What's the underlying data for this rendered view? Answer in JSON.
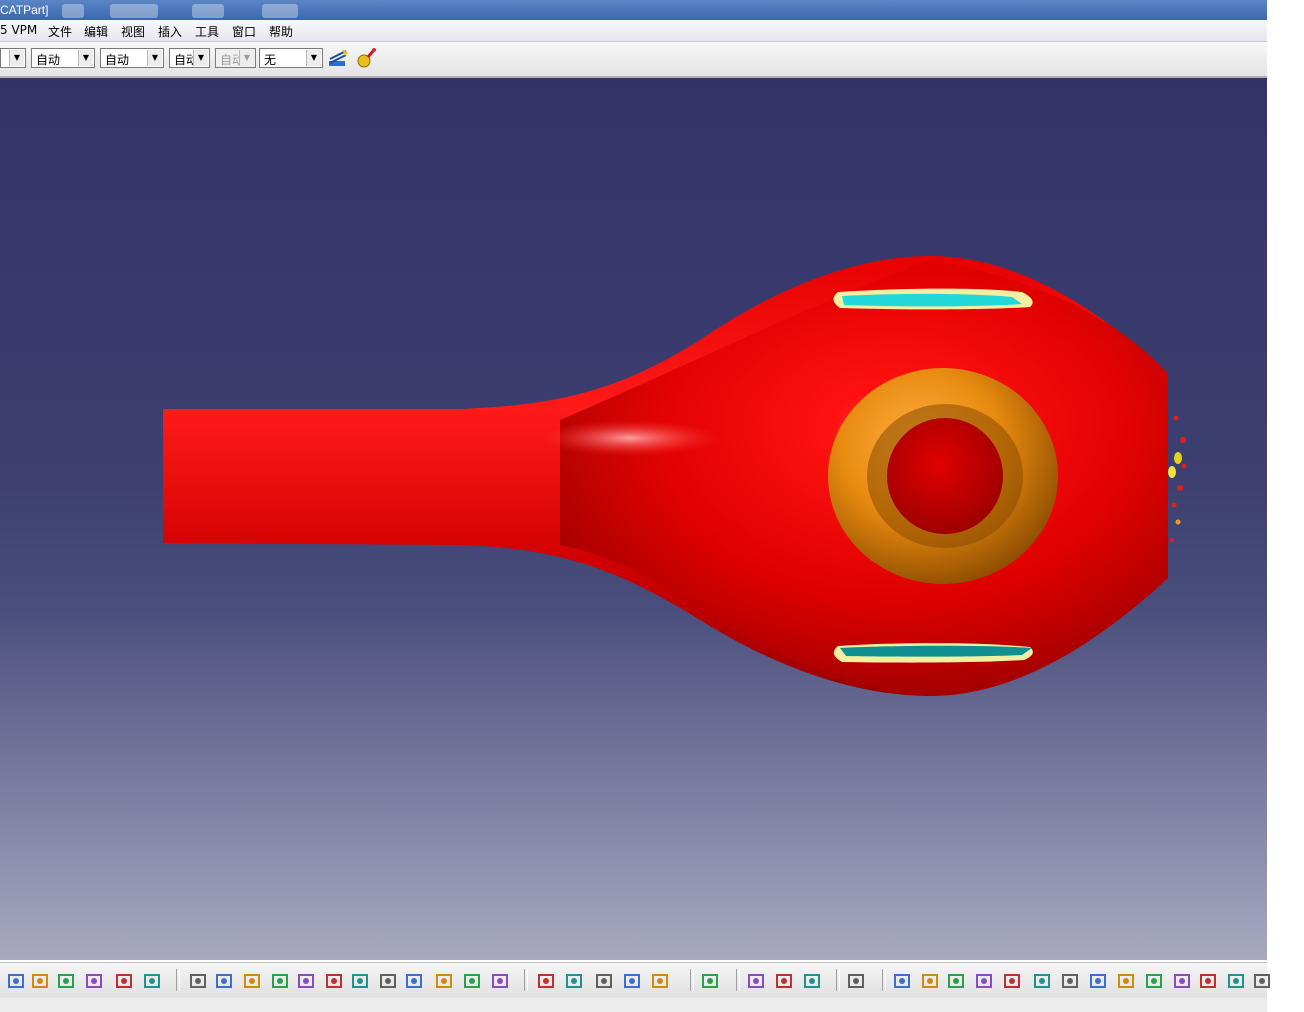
{
  "window": {
    "title": "CATPart]"
  },
  "menu": {
    "vpm": "5 VPM",
    "file": "文件",
    "edit": "编辑",
    "view": "视图",
    "insert": "插入",
    "tools": "工具",
    "window": "窗口",
    "help": "帮助"
  },
  "properties_toolbar": {
    "combo1": "",
    "color": "自动",
    "transparency": "自动",
    "line_weight": "自动",
    "line_type": "自动",
    "layer": "无"
  },
  "model": {
    "body_color": "#e00000",
    "ring_color": "#e88a10",
    "slot_color": "#22d8d8",
    "background_top": "#33336a",
    "background_bottom": "#a8a9c0"
  },
  "bottom_toolbar": {
    "icons": [
      "cut-icon",
      "copy-icon",
      "paste-icon",
      "undo-icon",
      "redo-icon",
      "whats-this-icon",
      "fly-mode-icon",
      "fit-all-icon",
      "pan-icon",
      "rotate-icon",
      "zoom-in-icon",
      "zoom-out-icon",
      "normal-view-icon",
      "multi-view-icon",
      "iso-view-icon",
      "shading-icon",
      "shading-edges-icon",
      "render-style-icon",
      "measure-icon",
      "measure-item-icon",
      "hole-icon",
      "pattern-icon",
      "part-icon",
      "tolerance-icon",
      "print-icon",
      "measure-between-icon",
      "measure-inertia-icon",
      "bottle-icon",
      "capture-icon",
      "rotate-view-icon",
      "hand-icon",
      "axis-icon",
      "tree-icon",
      "grid-icon",
      "cylinder-icon",
      "cube-icon",
      "sketch-icon",
      "knowledge-icon",
      "tree-expand-icon",
      "light-icon",
      "list-icon",
      "plane-icon",
      "more-icon"
    ]
  }
}
